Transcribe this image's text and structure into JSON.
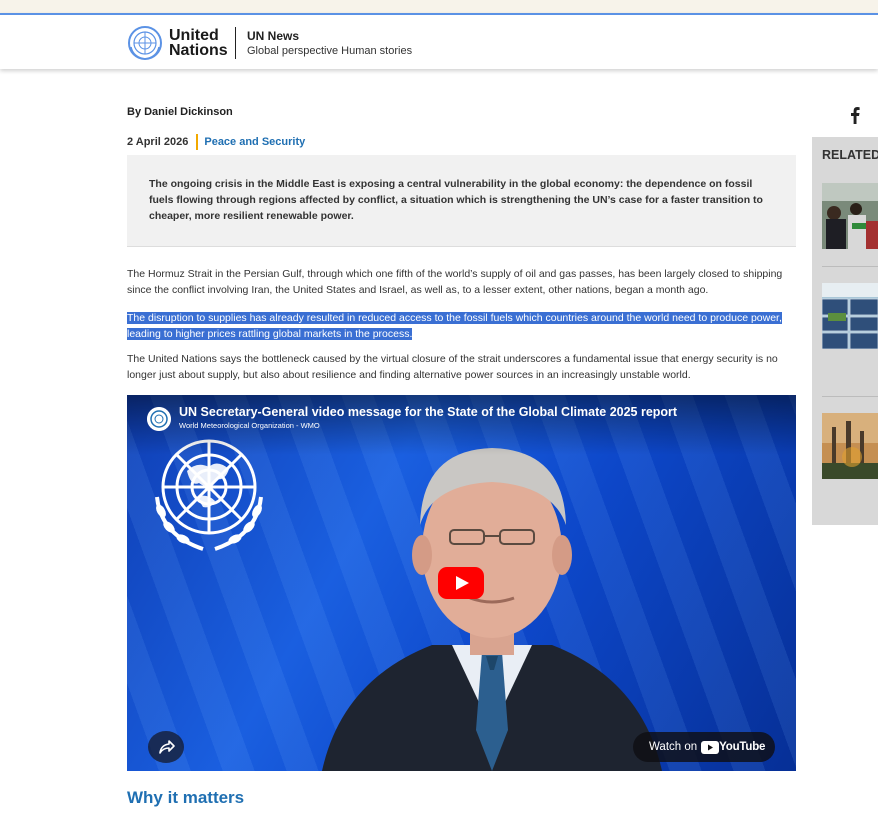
{
  "header": {
    "logo_line1": "United",
    "logo_line2": "Nations",
    "site_name": "UN News",
    "tagline": "Global perspective Human stories"
  },
  "article": {
    "byline": "By Daniel Dickinson",
    "date": "2 April 2026",
    "category": "Peace and Security",
    "lead": "The ongoing crisis in the Middle East is exposing a central vulnerability in the global economy: the dependence on fossil fuels flowing through regions affected by conflict, a situation which is strengthening the UN’s case for a faster transition to cheaper, more resilient renewable power.",
    "paragraphs": [
      "The Hormuz Strait in the Persian Gulf, through which one fifth of the world’s supply of oil and gas passes, has been largely closed to shipping since the conflict involving Iran, the United States and Israel, as well as, to a lesser extent, other nations, began a month ago.",
      "The disruption to supplies has already resulted in reduced access to the fossil fuels which countries around the world need to produce power, leading to higher prices rattling global markets in the process.",
      "The United Nations says the bottleneck caused by the virtual closure of the strait underscores a fundamental issue that energy security is no longer just about supply, but also about resilience and finding alternative power sources in an increasingly unstable world."
    ],
    "section_heading": "Why it matters"
  },
  "video": {
    "title": "UN Secretary-General video message for the State of the Global Climate 2025 report",
    "channel": "World Meteorological Organization - WMO",
    "watch_on": "Watch on",
    "youtube": "YouTube"
  },
  "sidebar": {
    "related_label": "RELATED"
  },
  "colors": {
    "accent_blue": "#1f6fb2",
    "category_separator": "#f2a900",
    "selection": "#3a6fd3",
    "youtube_red": "#ff0000"
  },
  "icons": [
    "un-emblem-icon",
    "facebook-icon",
    "play-icon",
    "share-icon",
    "youtube-logo-icon"
  ]
}
